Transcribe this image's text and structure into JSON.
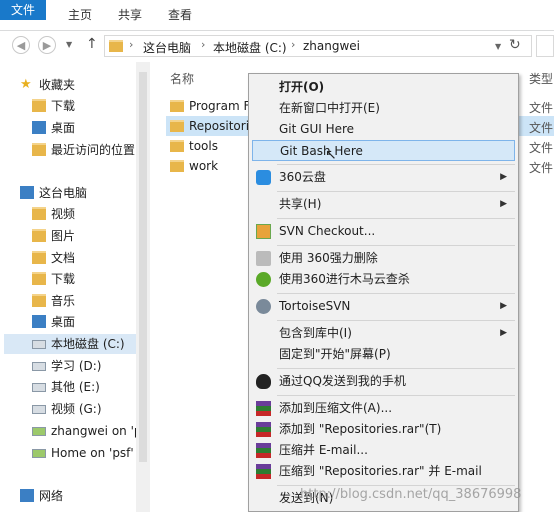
{
  "ribbon": {
    "tabs": [
      "文件",
      "主页",
      "共享",
      "查看"
    ]
  },
  "address": {
    "crumbs": [
      "这台电脑",
      "本地磁盘 (C:)",
      "zhangwei"
    ]
  },
  "sidebar": {
    "favorites_label": "收藏夹",
    "favorites": [
      "下载",
      "桌面",
      "最近访问的位置"
    ],
    "thispc_label": "这台电脑",
    "thispc": [
      "视频",
      "图片",
      "文档",
      "下载",
      "音乐",
      "桌面",
      "本地磁盘 (C:)",
      "学习 (D:)",
      "其他 (E:)",
      "视频 (G:)",
      "zhangwei on 'p",
      "Home on 'psf' ("
    ],
    "network_label": "网络"
  },
  "filelist": {
    "col_name": "名称",
    "col_type": "类型",
    "files": [
      "Program F",
      "Repositori",
      "tools",
      "work"
    ],
    "type_value": "文件"
  },
  "context_menu": {
    "items": [
      {
        "label": "打开(O)"
      },
      {
        "label": "在新窗口中打开(E)"
      },
      {
        "label": "Git GUI Here"
      },
      {
        "label": "Git Bash Here"
      },
      {
        "label": "360云盘"
      },
      {
        "label": "共享(H)"
      },
      {
        "label": "SVN Checkout..."
      },
      {
        "label": "使用 360强力删除"
      },
      {
        "label": "使用360进行木马云查杀"
      },
      {
        "label": "TortoiseSVN"
      },
      {
        "label": "包含到库中(I)"
      },
      {
        "label": "固定到\"开始\"屏幕(P)"
      },
      {
        "label": "通过QQ发送到我的手机"
      },
      {
        "label": "添加到压缩文件(A)..."
      },
      {
        "label": "添加到 \"Repositories.rar\"(T)"
      },
      {
        "label": "压缩并 E-mail..."
      },
      {
        "label": "压缩到 \"Repositories.rar\" 并 E-mail"
      },
      {
        "label": "发送到(N)"
      }
    ]
  },
  "watermark": "http://blog.csdn.net/qq_38676998",
  "colors": {
    "accent": "#1979ca",
    "menu_bg": "#f1f1f1",
    "highlight": "#d5e8f8",
    "folder": "#e8b64a"
  }
}
